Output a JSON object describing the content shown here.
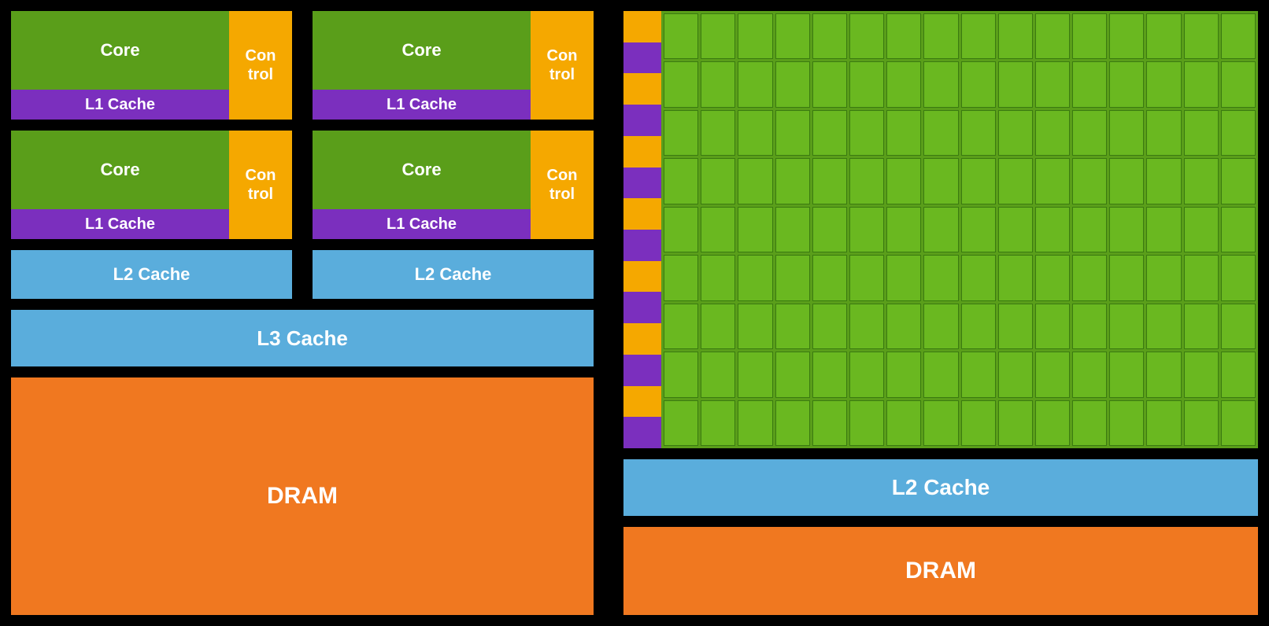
{
  "left": {
    "core_labels": [
      "Core",
      "Core",
      "Core",
      "Core"
    ],
    "control_label": "Con\ntrol",
    "l1_label": "L1 Cache",
    "l2_label": "L2 Cache",
    "l3_label": "L3 Cache",
    "dram_label": "DRAM"
  },
  "right": {
    "l2_label": "L2 Cache",
    "dram_label": "DRAM",
    "grid_cols": 16,
    "grid_rows": 9,
    "stripe_segments": 14
  },
  "colors": {
    "core": "#5a9e1a",
    "control": "#f5a800",
    "l1": "#7b2fbe",
    "l2": "#5aaddc",
    "l3": "#5aaddc",
    "dram": "#f07820",
    "stripe_gold": "#f5a800",
    "stripe_purple": "#7b2fbe"
  }
}
